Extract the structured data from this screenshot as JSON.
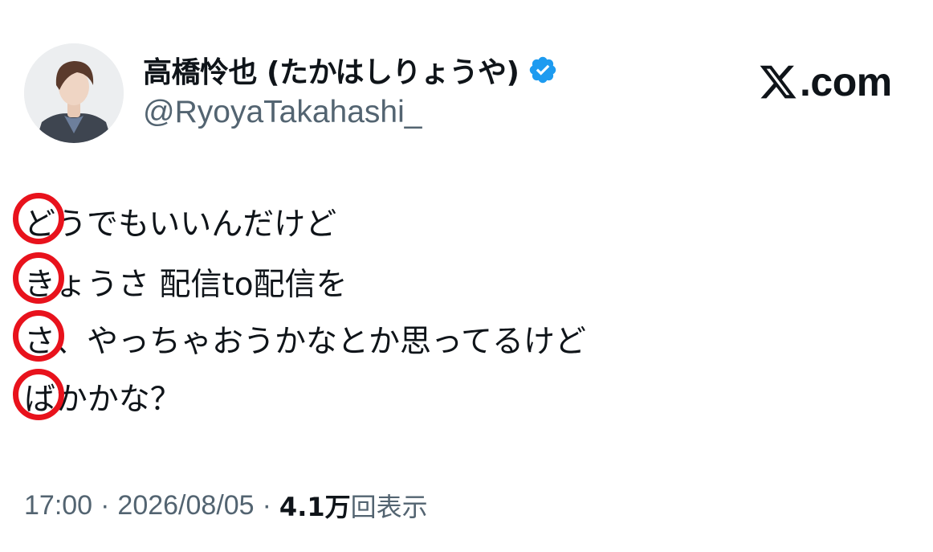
{
  "profile": {
    "display_name": "高橋怜也 (たかはしりょうや)",
    "handle": "@RyoyaTakahashi_",
    "avatar_icon": "profile-photo",
    "verified_icon": "verified-badge-icon",
    "verified_color": "#1d9bf0"
  },
  "brand": {
    "logo_icon": "x-logo-icon",
    "domain": ".com"
  },
  "tweet": {
    "lines": [
      "どうでもいいんだけど",
      "きょうさ 配信to配信を",
      "さ、やっちゃおうかなとか思ってるけど",
      "ばかかな？"
    ],
    "highlight_color": "#e8121c"
  },
  "meta": {
    "time": "17:00",
    "separator": "·",
    "date": "2026/08/05",
    "views_count": "4.1万",
    "views_label": "回表示"
  }
}
